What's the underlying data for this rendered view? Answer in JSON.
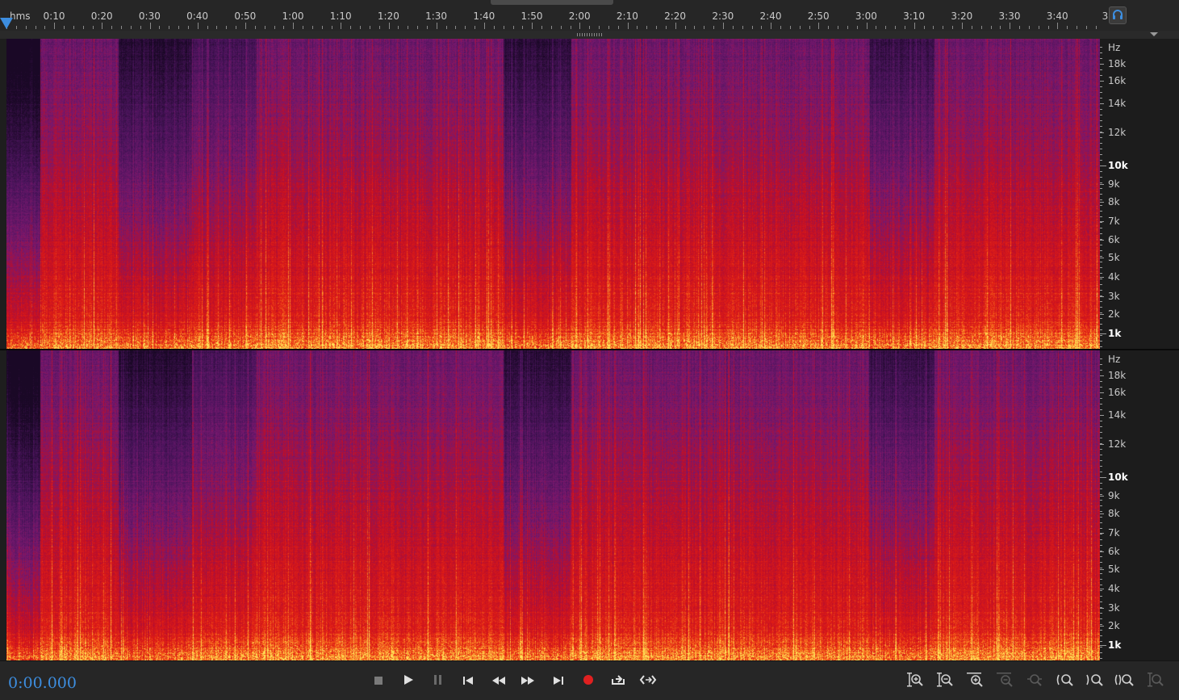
{
  "timeline": {
    "unit_label": "hms",
    "labels": [
      "0:10",
      "0:20",
      "0:30",
      "0:40",
      "0:50",
      "1:00",
      "1:10",
      "1:20",
      "1:30",
      "1:40",
      "1:50",
      "2:00",
      "2:10",
      "2:20",
      "2:30",
      "2:40",
      "2:50",
      "3:00",
      "3:10",
      "3:20",
      "3:30",
      "3:40",
      "3"
    ]
  },
  "frequency_scale": {
    "unit": "Hz",
    "labels": [
      "18k",
      "16k",
      "14k",
      "12k",
      "10k",
      "9k",
      "8k",
      "7k",
      "6k",
      "5k",
      "4k",
      "3k",
      "2k",
      "1k"
    ],
    "major": [
      "10k",
      "1k"
    ]
  },
  "channels": [
    "left",
    "right"
  ],
  "transport": {
    "time": "0:00.000",
    "buttons": [
      "stop",
      "play",
      "pause",
      "go-to-start",
      "rewind",
      "fast-forward",
      "go-to-end",
      "record",
      "loop",
      "skip-selection"
    ],
    "zoom_buttons": [
      "zoom-in-amplitude",
      "zoom-out-amplitude",
      "zoom-in-time",
      "zoom-out-time",
      "zoom-to-selection",
      "zoom-out-full-left",
      "zoom-in-point",
      "zoom-out-point",
      "zoom-reset"
    ]
  },
  "colors": {
    "accent": "#3d8ee0",
    "record": "#e02020",
    "spectrogram_low": "#2a0b3a",
    "spectrogram_mid": "#c8102e",
    "spectrogram_high": "#ffdd44"
  }
}
